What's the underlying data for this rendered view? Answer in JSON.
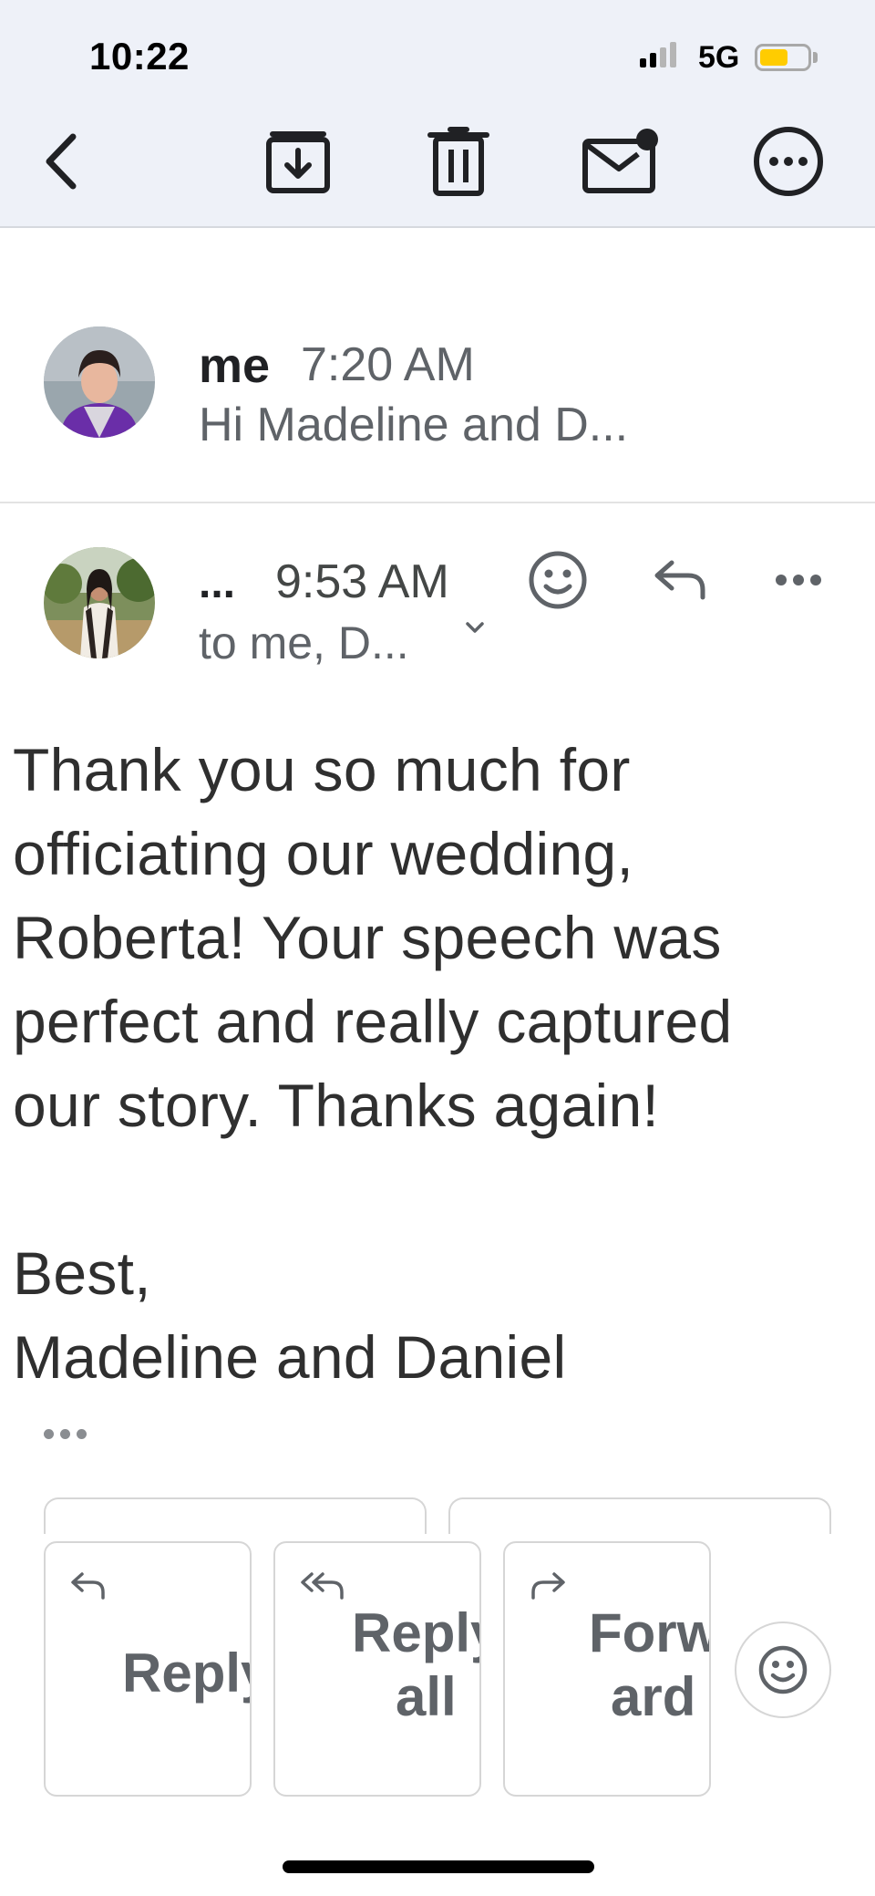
{
  "status_bar": {
    "time": "10:22",
    "network": "5G",
    "battery_level": 0.6,
    "battery_color": "#ffcc00"
  },
  "toolbar": {
    "back_icon": "chevron-left-icon",
    "archive_icon": "archive-icon",
    "delete_icon": "trash-icon",
    "mark_unread_icon": "mail-unread-icon",
    "more_icon": "more-horizontal-circle-icon"
  },
  "collapsed_message": {
    "sender": "me",
    "time": "7:20 AM",
    "snippet": "Hi Madeline and D..."
  },
  "open_message": {
    "sender": "...",
    "time": "9:53 AM",
    "recipients": "to me, D...",
    "body_lines": [
      "Thank you so much for",
      "officiating our wedding,",
      "Roberta! Your speech was",
      "perfect and really captured",
      "our story. Thanks again!"
    ],
    "signoff": "Best,",
    "signature": "Madeline and Daniel"
  },
  "actions": {
    "reply_label_1": "Reply",
    "reply_all_label_1": "Reply",
    "reply_all_label_2": "all",
    "forward_label_1": "Forw",
    "forward_label_2": "ard"
  },
  "colors": {
    "topbar_bg": "#eef1f8",
    "text_primary": "#202124",
    "text_secondary": "#5f6368"
  }
}
